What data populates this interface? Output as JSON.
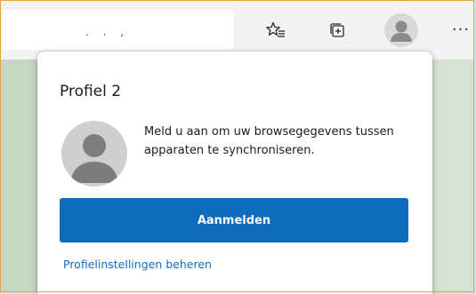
{
  "toolbar": {
    "address_fragment": ". . ,",
    "icons": {
      "favorites": "favorites-star-icon",
      "collections": "collections-icon",
      "profile": "profile-avatar-icon",
      "more": "more-dots-icon"
    }
  },
  "profile_flyout": {
    "title": "Profiel 2",
    "signin_message": "Meld u aan om uw browsegegevens tussen apparaten te synchroniseren.",
    "signin_button_label": "Aanmelden",
    "manage_link_label": "Profielinstellingen beheren"
  },
  "colors": {
    "accent": "#0f6cbd",
    "frame_border": "#e8a040",
    "page_background": "#d6e2d3",
    "avatar_gray": "#cfcfcf"
  }
}
